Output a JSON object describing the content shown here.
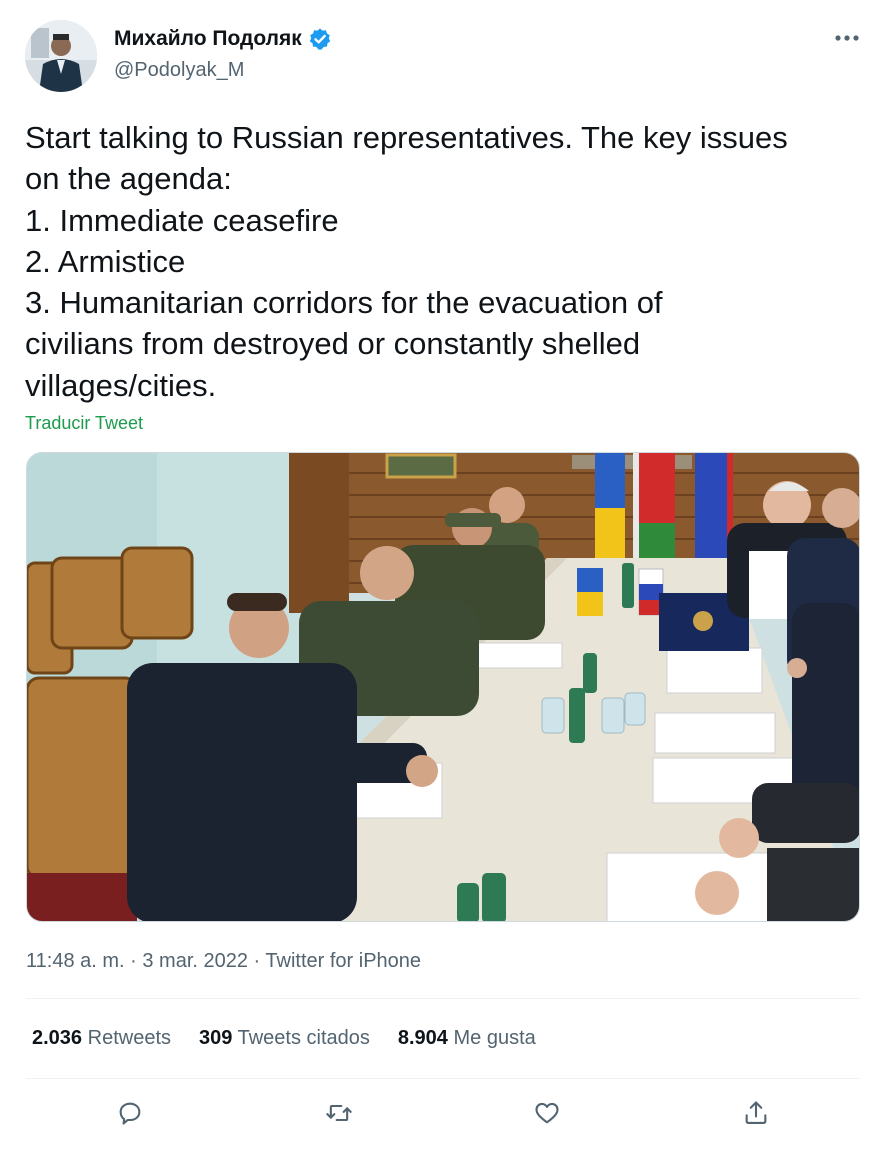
{
  "tweet": {
    "author": {
      "display_name": "Михайло Подоляк",
      "handle": "@Podolyak_M",
      "verified": true
    },
    "text_lines": [
      "Start talking to Russian representatives. The key issues",
      "on the agenda:",
      "1. Immediate ceasefire",
      "2. Armistice",
      "3. Humanitarian corridors for the evacuation of",
      "civilians from destroyed or constantly shelled",
      "villages/cities."
    ],
    "translate_label": "Traducir Tweet",
    "time": "11:48 a. m.",
    "separator": " · ",
    "date": "3 mar. 2022",
    "source": "Twitter for iPhone",
    "stats": {
      "retweets": {
        "count": "2.036",
        "label": "Retweets"
      },
      "quotes": {
        "count": "309",
        "label": "Tweets citados"
      },
      "likes": {
        "count": "8.904",
        "label": "Me gusta"
      }
    }
  },
  "icons": {
    "verified": "verified-badge-icon",
    "more": "more-options-icon",
    "reply": "reply-icon",
    "retweet": "retweet-icon",
    "like": "heart-icon",
    "share": "share-icon"
  },
  "colors": {
    "text": "#0f1419",
    "secondary": "#536471",
    "verified": "#1d9bf0",
    "translate_link": "#1d9b4f",
    "divider": "#eff3f4"
  }
}
